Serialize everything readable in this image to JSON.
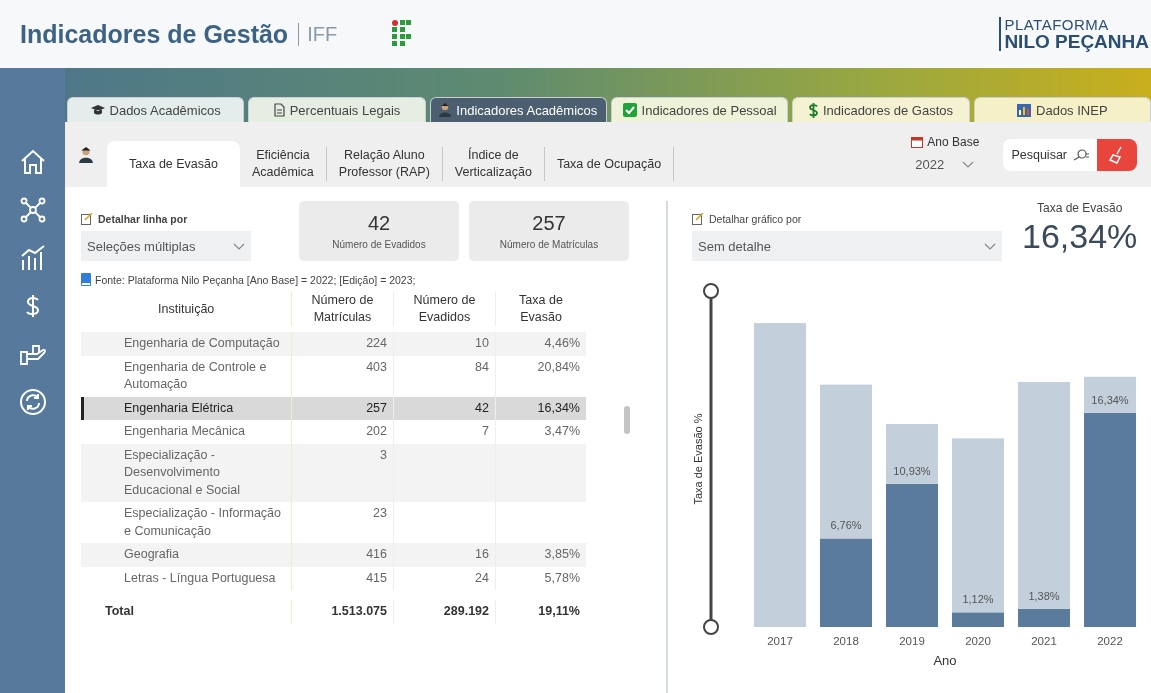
{
  "header": {
    "title": "Indicadores de Gestão",
    "org": "IFF",
    "brand_top": "PLATAFORMA",
    "brand_bottom": "NILO PEÇANHA"
  },
  "tabs": [
    {
      "label": "Dados Acadêmicos",
      "selected": false
    },
    {
      "label": "Percentuais Legais",
      "selected": false
    },
    {
      "label": "Indicadores Acadêmicos",
      "selected": true
    },
    {
      "label": "Indicadores de Pessoal",
      "selected": false
    },
    {
      "label": "Indicadores de Gastos",
      "selected": false
    },
    {
      "label": "Dados INEP",
      "selected": false
    }
  ],
  "subtabs": [
    {
      "label": "Taxa de Evasão",
      "selected": true
    },
    {
      "label": "Eficiência\nAcadêmica",
      "selected": false
    },
    {
      "label": "Relação Aluno\nProfessor (RAP)",
      "selected": false
    },
    {
      "label": "Índice de\nVerticalização",
      "selected": false
    },
    {
      "label": "Taxa de Ocupação",
      "selected": false
    }
  ],
  "year_filter": {
    "label": "Ano Base",
    "value": "2022"
  },
  "search_button": {
    "label": "Pesquisar"
  },
  "line_detail": {
    "label": "Detalhar linha por",
    "value": "Seleções múltiplas"
  },
  "cards": [
    {
      "value": "42",
      "label": "Número de Evadidos"
    },
    {
      "value": "257",
      "label": "Número de Matrículas"
    }
  ],
  "source": "Fonte: Plataforma Nilo Peçanha [Ano Base] = 2022; [Edição] = 2023;",
  "table": {
    "columns": [
      "Instituição",
      "Número de\nMatrículas",
      "Número de\nEvadidos",
      "Taxa de\nEvasão"
    ],
    "rows": [
      {
        "cells": [
          "Engenharia de Computação",
          "224",
          "10",
          "4,46%"
        ],
        "selected": false
      },
      {
        "cells": [
          "Engenharia de Controle e Automação",
          "403",
          "84",
          "20,84%"
        ],
        "selected": false
      },
      {
        "cells": [
          "Engenharia Elétrica",
          "257",
          "42",
          "16,34%"
        ],
        "selected": true
      },
      {
        "cells": [
          "Engenharia Mecânica",
          "202",
          "7",
          "3,47%"
        ],
        "selected": false
      },
      {
        "cells": [
          "Especialização - Desenvolvimento Educacional e Social",
          "3",
          "",
          ""
        ],
        "selected": false
      },
      {
        "cells": [
          "Especialização - Informação e Comunicação",
          "23",
          "",
          ""
        ],
        "selected": false
      },
      {
        "cells": [
          "Geografia",
          "416",
          "16",
          "3,85%"
        ],
        "selected": false
      },
      {
        "cells": [
          "Letras - Língua Portuguesa",
          "415",
          "24",
          "5,78%"
        ],
        "selected": false
      }
    ],
    "total": [
      "Total",
      "1.513.075",
      "289.192",
      "19,11%"
    ]
  },
  "chart_detail": {
    "label": "Detalhar gráfico por",
    "value": "Sem detalhe"
  },
  "kpi": {
    "label": "Taxa de Evasão",
    "value": "16,34%"
  },
  "chart_data": {
    "type": "bar",
    "xlabel": "Ano",
    "ylabel": "Taxa de Evasão %",
    "categories": [
      "2017",
      "2018",
      "2019",
      "2020",
      "2021",
      "2022"
    ],
    "stacked": true,
    "series": [
      {
        "color": "#5b7b9c",
        "values": [
          null,
          6.76,
          10.93,
          1.12,
          1.38,
          16.34
        ],
        "value_labels": [
          null,
          "6,76%",
          "10,93%",
          "1,12%",
          "1,38%",
          "16,34%"
        ]
      },
      {
        "color": "#c3d0dc",
        "values": [
          23.2,
          11.74,
          4.57,
          13.28,
          17.32,
          2.76
        ]
      }
    ]
  }
}
